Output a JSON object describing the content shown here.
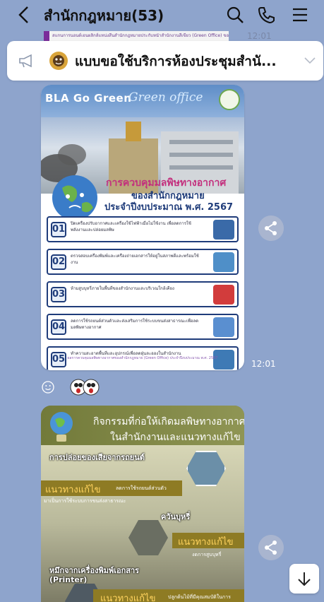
{
  "header": {
    "title": "สำนักกฎหมาย(53)",
    "icons": [
      "chevron-left-icon",
      "search-icon",
      "phone-icon",
      "menu-icon"
    ]
  },
  "peek_message": {
    "text": "สแกนการนอนด์เอนผลิกส์แหน่งสีนสำนักกฎหมายประกับหนัาสำนักงานสีเขียว (Green Office) ของสำนักกฎหมาย",
    "time": "12:01"
  },
  "announcement": {
    "text": "แบบขอใช้บริการห้องประชุมสำนั...",
    "icon": "megaphone-icon"
  },
  "poster1": {
    "banner_left": "BLA Go Green",
    "banner_right": "Green office",
    "title_line1": "การควบคุมมลพิษทางอากาศ",
    "title_line2": "ของสำนักกฎหมาย",
    "title_line3": "ประจำปีงบประมาณ พ.ศ. 2567",
    "rows": [
      {
        "num": "01",
        "text": "ปิดเครื่องปรับอากาศและเครื่องใช้ไฟฟ้าเมื่อไม่ใช้งาน เพื่อลดการใช้พลังงานและปล่อยมลพิษ"
      },
      {
        "num": "02",
        "text": "ตรวจสอบเครื่องพิมพ์และเครื่องถ่ายเอกสารให้อยู่ในสภาพดีและพร้อมใช้งาน"
      },
      {
        "num": "03",
        "text": "ห้ามสูบบุหรี่ภายในพื้นที่ของสำนักงานและบริเวณใกล้เคียง"
      },
      {
        "num": "04",
        "text": "ลดการใช้รถยนต์ส่วนตัวและส่งเสริมการใช้ระบบขนส่งสาธารณะเพื่อลดมลพิษทางอากาศ"
      },
      {
        "num": "05",
        "text": "ทำความสะอาดพื้นที่และอุปกรณ์เพื่อลดฝุ่นละอองในสำนักงาน"
      }
    ],
    "footer": "ผลการควบคุมมลพิษทางอากาศของสำนักกฎหมาย (Green Office) ประจำปีงบประมาณ พ.ศ. 2567",
    "time": "12:01"
  },
  "reactions": {
    "smile_icon": "smile-icon",
    "emoji": "surprised-faces-sticker"
  },
  "poster2": {
    "heading_line1": "กิจกรรมที่ก่อให้เกิดมลพิษทางอากาศ",
    "heading_line2": "ในสำนักงานและแนวทางแก้ไข",
    "sec1_title": "การปล่อยของเสียจากรถยนต์",
    "sec1_solution": "แนวทางแก้ไข",
    "sec1_desc": "ลดการใช้รถยนต์ส่วนตัว",
    "sec1_desc2": "มาเป็นการใช้ระบบการขนส่งสาธารณะ",
    "sec2_title": "ควันบุหรี่",
    "sec2_solution": "แนวทางแก้ไข",
    "sec2_desc": "งดการสูบบุหรี่",
    "sec3_title": "หมึกจากเครื่องพิมพ์เอกสาร",
    "sec3_sub": "(Printer)",
    "sec3_solution": "แนวทางแก้ไข",
    "sec3_desc": "ปลูกต้นไม้ที่มีคุณสมบัติในการ"
  },
  "colors": {
    "background": "#8ea4cc",
    "poster_magenta": "#c32f7d",
    "poster_navy": "#1f3c7a",
    "solution_gold": "#ffd35e"
  }
}
